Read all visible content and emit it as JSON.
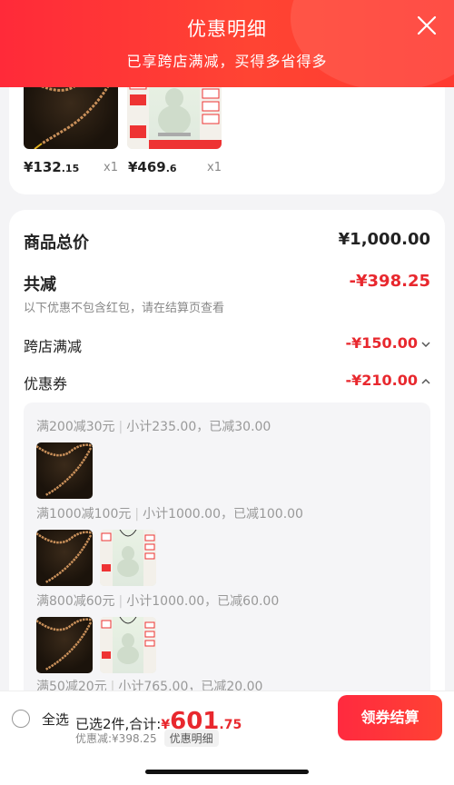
{
  "header": {
    "title": "优惠明细",
    "subtitle": "已享跨店满减，买得多省得多"
  },
  "top_items": [
    {
      "price_main": "¥132",
      "price_dec": ".15",
      "qty": "x1",
      "image": "necklace"
    },
    {
      "price_main": "¥469",
      "price_dec": ".6",
      "qty": "x1",
      "image": "jade-buddha"
    }
  ],
  "summary": {
    "total_label": "商品总价",
    "total_value": "¥1,000.00",
    "reduce_label": "共减",
    "reduce_value": "-¥398.25",
    "note": "以下优惠不包含红包，请在结算页查看",
    "cross_store_label": "跨店满减",
    "cross_store_value": "-¥150.00",
    "coupon_label": "优惠券",
    "coupon_value": "-¥210.00"
  },
  "coupons": [
    {
      "rule": "满200减30元",
      "detail": "小计235.00，已减30.00",
      "items": [
        "necklace"
      ]
    },
    {
      "rule": "满1000减100元",
      "detail": "小计1000.00，已减100.00",
      "items": [
        "necklace",
        "jade-buddha"
      ]
    },
    {
      "rule": "满800减60元",
      "detail": "小计1000.00，已减60.00",
      "items": [
        "necklace",
        "jade-buddha"
      ]
    },
    {
      "rule": "满50减20元",
      "detail": "小计765.00，已减20.00",
      "items": []
    }
  ],
  "footer": {
    "select_all": "全选",
    "selected_prefix": "已选2件,合计:",
    "currency": "¥",
    "total_main": "601",
    "total_dec": ".75",
    "discount_text": "优惠减:¥398.25",
    "detail_tag": "优惠明细",
    "checkout_label": "领券结算"
  },
  "colors": {
    "accent": "#ff3a30",
    "price_red": "#e8282e"
  }
}
